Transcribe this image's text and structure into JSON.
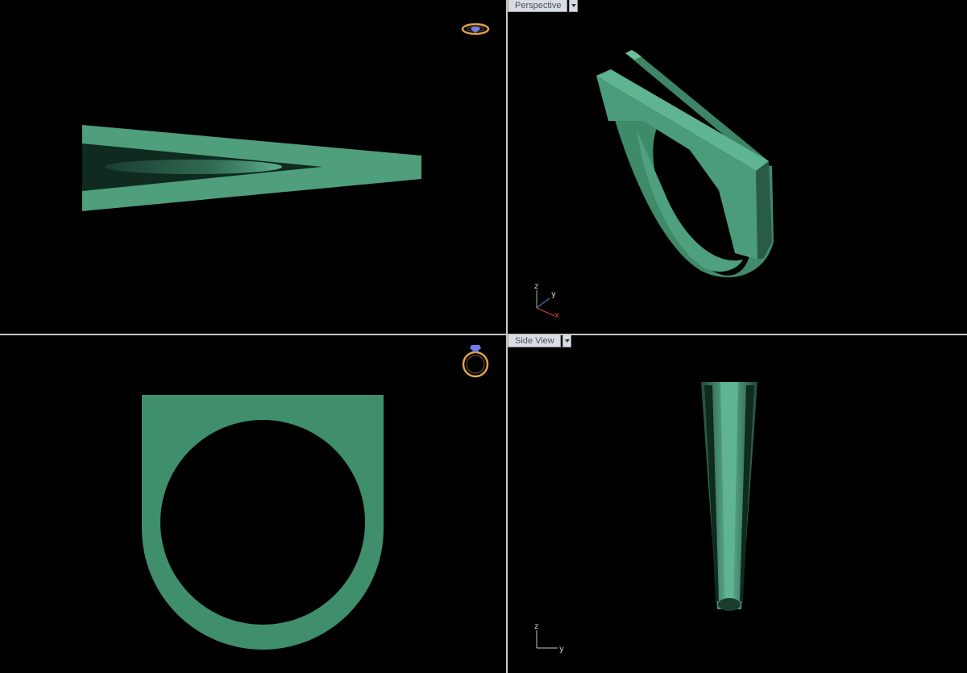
{
  "viewports": {
    "top": {
      "label": ""
    },
    "perspective": {
      "label": "Perspective"
    },
    "front": {
      "label": ""
    },
    "side": {
      "label": "Side View"
    }
  },
  "axes": {
    "x": "x",
    "y": "y",
    "z": "z"
  },
  "colors": {
    "model": "#4f9f7d",
    "model_dark": "#2c6049",
    "background": "#000000",
    "divider": "#c8c8c8"
  },
  "icons": {
    "top_widget": "ring-preview-icon",
    "front_widget": "ring-preview-icon"
  }
}
